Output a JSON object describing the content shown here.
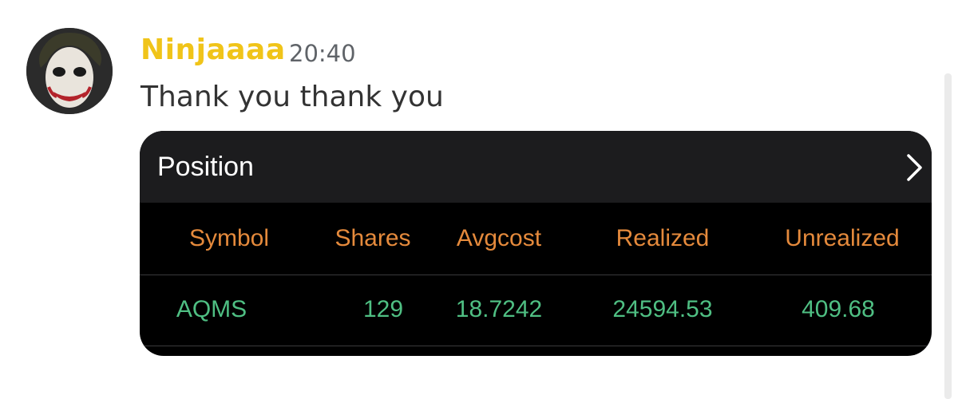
{
  "message": {
    "username": "Ninjaaaa",
    "timestamp": "20:40",
    "text": "Thank you thank you"
  },
  "card": {
    "title": "Position",
    "columns": [
      "Symbol",
      "Shares",
      "Avgcost",
      "Realized",
      "Unrealized"
    ],
    "rows": [
      [
        "AQMS",
        "129",
        "18.7242",
        "24594.53",
        "409.68"
      ]
    ]
  },
  "colors": {
    "username": "#f0c419",
    "header_text": "#e58a3c",
    "value_text": "#4fbf83",
    "card_bg": "#000000",
    "card_header_bg": "#1c1c1e"
  },
  "icons": {
    "avatar": "joker-face-avatar",
    "chevron": "chevron-right-icon"
  }
}
